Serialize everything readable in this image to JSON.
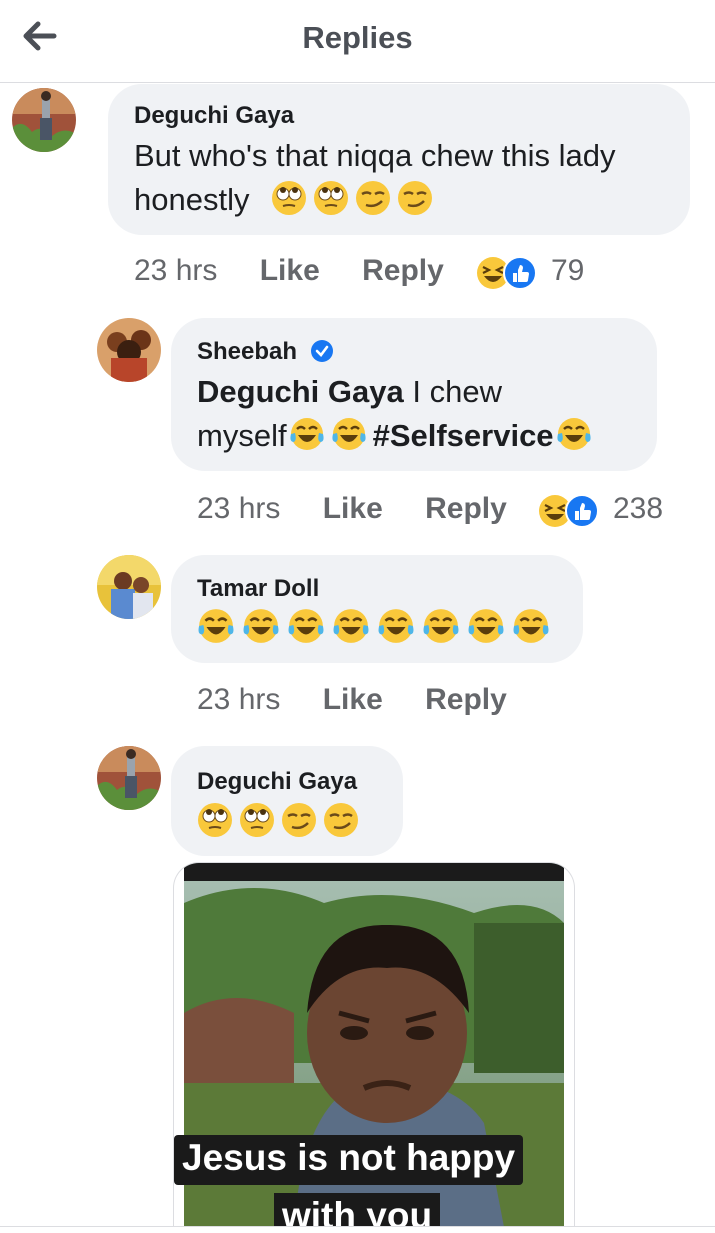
{
  "header": {
    "title": "Replies",
    "back_icon": "back-arrow-icon"
  },
  "comments": [
    {
      "author": "Deguchi Gaya",
      "text_line1": "But who's that niqqa chew this lady",
      "text_line2": "honestly",
      "emojis": [
        "rolling-eyes",
        "rolling-eyes",
        "smirking-face",
        "smirking-face"
      ],
      "time": "23 hrs",
      "like_label": "Like",
      "reply_label": "Reply",
      "reactions": [
        "laughing-reaction",
        "like-reaction"
      ],
      "reaction_count": "79"
    },
    {
      "author": "Sheebah",
      "verified": true,
      "mention": "Deguchi Gaya",
      "text_after_mention": " I chew",
      "text_line2": "myself",
      "hashtag": "#Selfservice",
      "time": "23 hrs",
      "like_label": "Like",
      "reply_label": "Reply",
      "reactions": [
        "laughing-reaction",
        "like-reaction"
      ],
      "reaction_count": "238"
    },
    {
      "author": "Tamar Doll",
      "emojis": [
        "tears-of-joy",
        "tears-of-joy",
        "tears-of-joy",
        "tears-of-joy",
        "tears-of-joy",
        "tears-of-joy",
        "tears-of-joy",
        "tears-of-joy"
      ],
      "time": "23 hrs",
      "like_label": "Like",
      "reply_label": "Reply"
    },
    {
      "author": "Deguchi Gaya",
      "emojis": [
        "rolling-eyes",
        "rolling-eyes",
        "smirking-face",
        "smirking-face"
      ],
      "media_caption_line1": "Jesus is not happy",
      "media_caption_line2": "with you"
    }
  ],
  "colors": {
    "bubble": "#f0f2f5",
    "text": "#1c1e21",
    "meta": "#65676b",
    "verified": "#1877f2",
    "like_blue": "#1877f2"
  }
}
